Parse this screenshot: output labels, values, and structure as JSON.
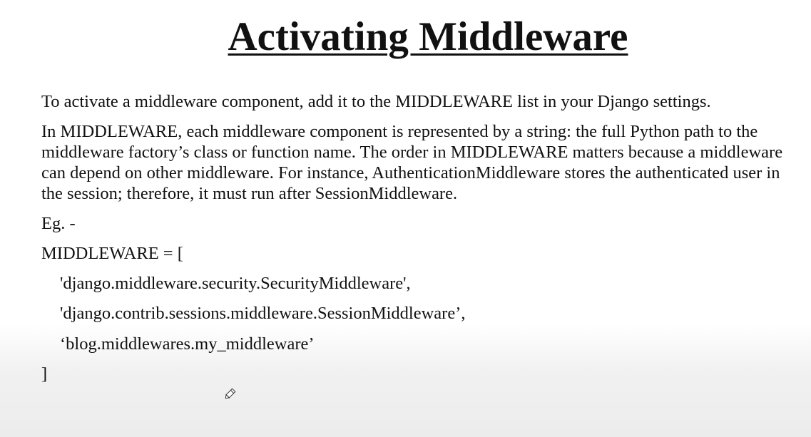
{
  "slide": {
    "title": "Activating Middleware",
    "paragraph1": "To activate a middleware component, add it to the MIDDLEWARE list in your Django settings.",
    "paragraph2": "In MIDDLEWARE, each middleware component is represented by a string: the full Python path to the middleware factory’s class or function name. The order in MIDDLEWARE matters because a middleware can depend on other middleware. For instance, AuthenticationMiddleware stores the authenticated user in the session; therefore, it must run after SessionMiddleware.",
    "example_label": "Eg. -",
    "code": {
      "open": "MIDDLEWARE = [",
      "items": [
        "'django.middleware.security.SecurityMiddleware',",
        "'django.contrib.sessions.middleware.SessionMiddleware’,",
        "‘blog.middlewares.my_middleware’"
      ],
      "close": "]"
    }
  },
  "cursor": {
    "icon": "pen-cursor-icon"
  }
}
